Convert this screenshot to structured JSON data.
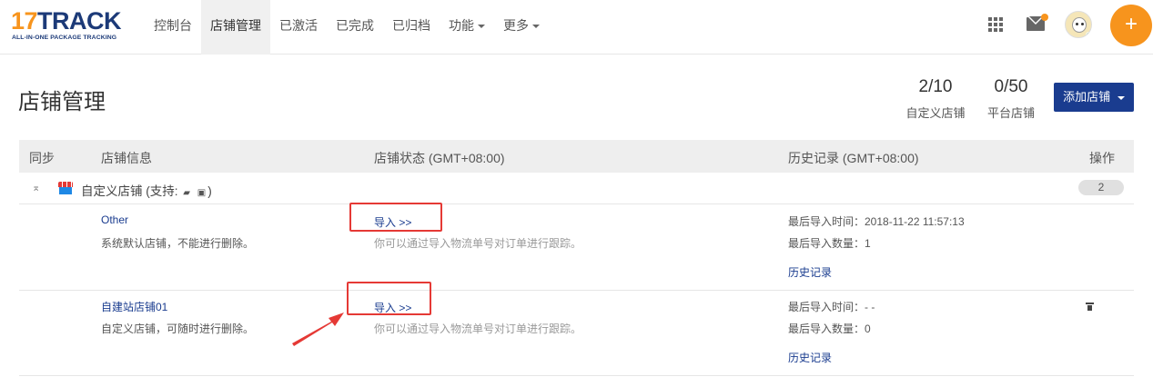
{
  "logo": {
    "brand_a": "17",
    "brand_b": "TRACK",
    "tagline": "ALL-IN-ONE PACKAGE TRACKING"
  },
  "nav": [
    {
      "label": "控制台"
    },
    {
      "label": "店铺管理",
      "active": true
    },
    {
      "label": "已激活"
    },
    {
      "label": "已完成"
    },
    {
      "label": "已归档"
    },
    {
      "label": "功能",
      "dropdown": true
    },
    {
      "label": "更多",
      "dropdown": true
    }
  ],
  "topRight": {
    "icons": [
      "apps-grid-icon",
      "mail-icon",
      "avatar",
      "plus-icon"
    ],
    "plus_label": "+"
  },
  "header": {
    "title": "店铺管理",
    "stats": [
      {
        "value": "2/10",
        "label": "自定义店铺"
      },
      {
        "value": "0/50",
        "label": "平台店铺"
      }
    ],
    "add_button": "添加店铺"
  },
  "table": {
    "columns": {
      "sync": "同步",
      "info": "店铺信息",
      "status": "店铺状态 (GMT+08:00)",
      "history": "历史记录 (GMT+08:00)",
      "actions": "操作"
    },
    "group": {
      "collapse_glyph": "⌅",
      "label_prefix": "自定义店铺 (支持:",
      "label_suffix": ")",
      "support_icons": [
        "card-icon",
        "clipboard-icon"
      ],
      "count": "2"
    },
    "rows": [
      {
        "name": "Other",
        "desc": "系统默认店铺，不能进行删除。",
        "import": "导入 >>",
        "import_tip": "你可以通过导入物流单号对订单进行跟踪。",
        "last_import_time": "最后导入时间：2018-11-22 11:57:13",
        "last_import_count": "最后导入数量：1",
        "history_link": "历史记录",
        "deletable": false
      },
      {
        "name": "自建站店铺01",
        "desc": "自定义店铺，可随时进行删除。",
        "import": "导入 >>",
        "import_tip": "你可以通过导入物流单号对订单进行跟踪。",
        "last_import_time": "最后导入时间：- -",
        "last_import_count": "最后导入数量：0",
        "history_link": "历史记录",
        "deletable": true
      }
    ]
  },
  "colors": {
    "brand": "#1a3c8f",
    "accent": "#f7941d",
    "annotation": "#e53935"
  }
}
